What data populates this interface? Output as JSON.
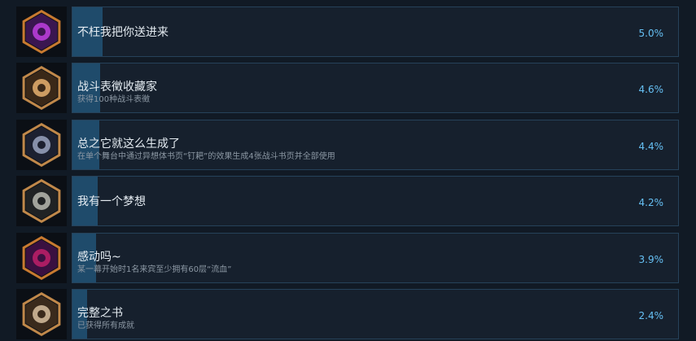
{
  "achievements": [
    {
      "title": "不枉我把你送进来",
      "description": "",
      "percent": "5.0%",
      "fill": 0.05,
      "icon": "purple-crown-emblem-icon",
      "ring_color": "#c87a30",
      "inner_color": "#3a1650",
      "accent_color": "#c040e0"
    },
    {
      "title": "战斗表徵收藏家",
      "description": "获得100种战斗表徵",
      "percent": "4.6%",
      "fill": 0.046,
      "icon": "golden-tree-emblem-icon",
      "ring_color": "#c0884a",
      "inner_color": "#3a2818",
      "accent_color": "#e8b070"
    },
    {
      "title": "总之它就这么生成了",
      "description": "在单个舞台中通过异想体书页“钉耙”的效果生成4张战斗书页并全部使用",
      "percent": "4.4%",
      "fill": 0.044,
      "icon": "dark-haired-character-portrait-icon",
      "ring_color": "#c0884a",
      "inner_color": "#1c2030",
      "accent_color": "#9aa4c0"
    },
    {
      "title": "我有一个梦想",
      "description": "",
      "percent": "4.2%",
      "fill": 0.042,
      "icon": "gray-haired-character-portrait-icon",
      "ring_color": "#c0884a",
      "inner_color": "#202224",
      "accent_color": "#b8b8b0"
    },
    {
      "title": "感动吗~",
      "description": "某一幕开始时1名来宾至少拥有60层“流血”",
      "percent": "3.9%",
      "fill": 0.039,
      "icon": "red-purple-blood-emblem-icon",
      "ring_color": "#c87a30",
      "inner_color": "#3a1040",
      "accent_color": "#c0206a"
    },
    {
      "title": "完整之书",
      "description": "已获得所有成就",
      "percent": "2.4%",
      "fill": 0.024,
      "icon": "bookshelf-character-emblem-icon",
      "ring_color": "#c0884a",
      "inner_color": "#3a2a1c",
      "accent_color": "#d8c0a0"
    }
  ]
}
